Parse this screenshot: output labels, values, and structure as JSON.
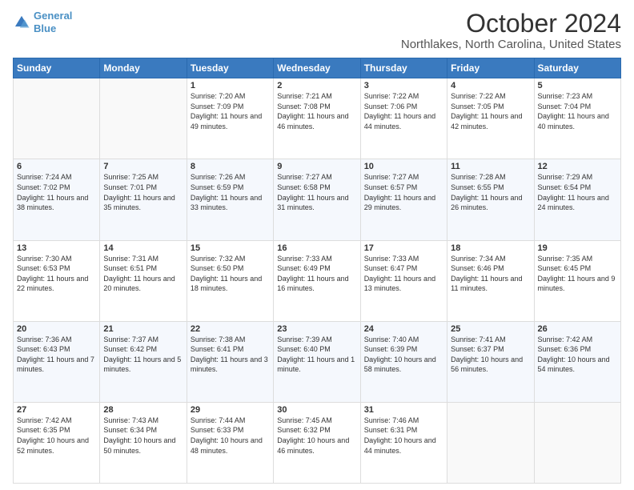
{
  "logo": {
    "line1": "General",
    "line2": "Blue"
  },
  "title": "October 2024",
  "subtitle": "Northlakes, North Carolina, United States",
  "days_of_week": [
    "Sunday",
    "Monday",
    "Tuesday",
    "Wednesday",
    "Thursday",
    "Friday",
    "Saturday"
  ],
  "weeks": [
    [
      {
        "num": "",
        "sunrise": "",
        "sunset": "",
        "daylight": ""
      },
      {
        "num": "",
        "sunrise": "",
        "sunset": "",
        "daylight": ""
      },
      {
        "num": "1",
        "sunrise": "Sunrise: 7:20 AM",
        "sunset": "Sunset: 7:09 PM",
        "daylight": "Daylight: 11 hours and 49 minutes."
      },
      {
        "num": "2",
        "sunrise": "Sunrise: 7:21 AM",
        "sunset": "Sunset: 7:08 PM",
        "daylight": "Daylight: 11 hours and 46 minutes."
      },
      {
        "num": "3",
        "sunrise": "Sunrise: 7:22 AM",
        "sunset": "Sunset: 7:06 PM",
        "daylight": "Daylight: 11 hours and 44 minutes."
      },
      {
        "num": "4",
        "sunrise": "Sunrise: 7:22 AM",
        "sunset": "Sunset: 7:05 PM",
        "daylight": "Daylight: 11 hours and 42 minutes."
      },
      {
        "num": "5",
        "sunrise": "Sunrise: 7:23 AM",
        "sunset": "Sunset: 7:04 PM",
        "daylight": "Daylight: 11 hours and 40 minutes."
      }
    ],
    [
      {
        "num": "6",
        "sunrise": "Sunrise: 7:24 AM",
        "sunset": "Sunset: 7:02 PM",
        "daylight": "Daylight: 11 hours and 38 minutes."
      },
      {
        "num": "7",
        "sunrise": "Sunrise: 7:25 AM",
        "sunset": "Sunset: 7:01 PM",
        "daylight": "Daylight: 11 hours and 35 minutes."
      },
      {
        "num": "8",
        "sunrise": "Sunrise: 7:26 AM",
        "sunset": "Sunset: 6:59 PM",
        "daylight": "Daylight: 11 hours and 33 minutes."
      },
      {
        "num": "9",
        "sunrise": "Sunrise: 7:27 AM",
        "sunset": "Sunset: 6:58 PM",
        "daylight": "Daylight: 11 hours and 31 minutes."
      },
      {
        "num": "10",
        "sunrise": "Sunrise: 7:27 AM",
        "sunset": "Sunset: 6:57 PM",
        "daylight": "Daylight: 11 hours and 29 minutes."
      },
      {
        "num": "11",
        "sunrise": "Sunrise: 7:28 AM",
        "sunset": "Sunset: 6:55 PM",
        "daylight": "Daylight: 11 hours and 26 minutes."
      },
      {
        "num": "12",
        "sunrise": "Sunrise: 7:29 AM",
        "sunset": "Sunset: 6:54 PM",
        "daylight": "Daylight: 11 hours and 24 minutes."
      }
    ],
    [
      {
        "num": "13",
        "sunrise": "Sunrise: 7:30 AM",
        "sunset": "Sunset: 6:53 PM",
        "daylight": "Daylight: 11 hours and 22 minutes."
      },
      {
        "num": "14",
        "sunrise": "Sunrise: 7:31 AM",
        "sunset": "Sunset: 6:51 PM",
        "daylight": "Daylight: 11 hours and 20 minutes."
      },
      {
        "num": "15",
        "sunrise": "Sunrise: 7:32 AM",
        "sunset": "Sunset: 6:50 PM",
        "daylight": "Daylight: 11 hours and 18 minutes."
      },
      {
        "num": "16",
        "sunrise": "Sunrise: 7:33 AM",
        "sunset": "Sunset: 6:49 PM",
        "daylight": "Daylight: 11 hours and 16 minutes."
      },
      {
        "num": "17",
        "sunrise": "Sunrise: 7:33 AM",
        "sunset": "Sunset: 6:47 PM",
        "daylight": "Daylight: 11 hours and 13 minutes."
      },
      {
        "num": "18",
        "sunrise": "Sunrise: 7:34 AM",
        "sunset": "Sunset: 6:46 PM",
        "daylight": "Daylight: 11 hours and 11 minutes."
      },
      {
        "num": "19",
        "sunrise": "Sunrise: 7:35 AM",
        "sunset": "Sunset: 6:45 PM",
        "daylight": "Daylight: 11 hours and 9 minutes."
      }
    ],
    [
      {
        "num": "20",
        "sunrise": "Sunrise: 7:36 AM",
        "sunset": "Sunset: 6:43 PM",
        "daylight": "Daylight: 11 hours and 7 minutes."
      },
      {
        "num": "21",
        "sunrise": "Sunrise: 7:37 AM",
        "sunset": "Sunset: 6:42 PM",
        "daylight": "Daylight: 11 hours and 5 minutes."
      },
      {
        "num": "22",
        "sunrise": "Sunrise: 7:38 AM",
        "sunset": "Sunset: 6:41 PM",
        "daylight": "Daylight: 11 hours and 3 minutes."
      },
      {
        "num": "23",
        "sunrise": "Sunrise: 7:39 AM",
        "sunset": "Sunset: 6:40 PM",
        "daylight": "Daylight: 11 hours and 1 minute."
      },
      {
        "num": "24",
        "sunrise": "Sunrise: 7:40 AM",
        "sunset": "Sunset: 6:39 PM",
        "daylight": "Daylight: 10 hours and 58 minutes."
      },
      {
        "num": "25",
        "sunrise": "Sunrise: 7:41 AM",
        "sunset": "Sunset: 6:37 PM",
        "daylight": "Daylight: 10 hours and 56 minutes."
      },
      {
        "num": "26",
        "sunrise": "Sunrise: 7:42 AM",
        "sunset": "Sunset: 6:36 PM",
        "daylight": "Daylight: 10 hours and 54 minutes."
      }
    ],
    [
      {
        "num": "27",
        "sunrise": "Sunrise: 7:42 AM",
        "sunset": "Sunset: 6:35 PM",
        "daylight": "Daylight: 10 hours and 52 minutes."
      },
      {
        "num": "28",
        "sunrise": "Sunrise: 7:43 AM",
        "sunset": "Sunset: 6:34 PM",
        "daylight": "Daylight: 10 hours and 50 minutes."
      },
      {
        "num": "29",
        "sunrise": "Sunrise: 7:44 AM",
        "sunset": "Sunset: 6:33 PM",
        "daylight": "Daylight: 10 hours and 48 minutes."
      },
      {
        "num": "30",
        "sunrise": "Sunrise: 7:45 AM",
        "sunset": "Sunset: 6:32 PM",
        "daylight": "Daylight: 10 hours and 46 minutes."
      },
      {
        "num": "31",
        "sunrise": "Sunrise: 7:46 AM",
        "sunset": "Sunset: 6:31 PM",
        "daylight": "Daylight: 10 hours and 44 minutes."
      },
      {
        "num": "",
        "sunrise": "",
        "sunset": "",
        "daylight": ""
      },
      {
        "num": "",
        "sunrise": "",
        "sunset": "",
        "daylight": ""
      }
    ]
  ]
}
